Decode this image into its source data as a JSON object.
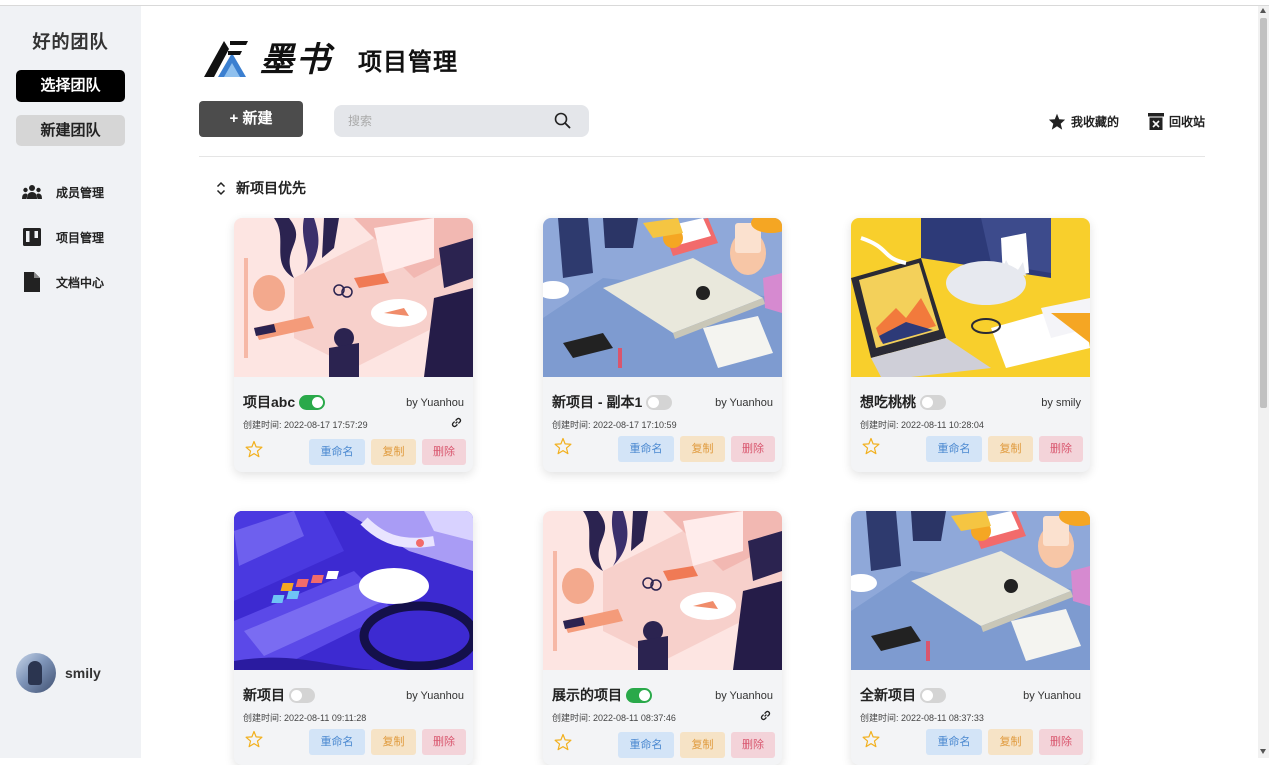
{
  "sidebar": {
    "team_name": "好的团队",
    "select_team_label": "选择团队",
    "new_team_label": "新建团队",
    "nav": [
      {
        "label": "成员管理",
        "icon": "users-icon"
      },
      {
        "label": "项目管理",
        "icon": "kanban-icon"
      },
      {
        "label": "文档中心",
        "icon": "document-icon"
      }
    ],
    "user": {
      "name": "smily"
    }
  },
  "header": {
    "logo_text": "墨书",
    "page_title": "项目管理",
    "new_button_label": "+ 新建",
    "search_placeholder": "搜索",
    "favorites_label": "我收藏的",
    "recycle_label": "回收站",
    "sort_label": "新项目优先"
  },
  "card_actions": {
    "rename": "重命名",
    "copy": "复制",
    "delete": "删除"
  },
  "projects": [
    {
      "title": "项目abc",
      "enabled": true,
      "author": "by Yuanhou",
      "created": "创建时间: 2022-08-17 17:57:29",
      "shared": true,
      "image": "desk-pink"
    },
    {
      "title": "新项目 - 副本1",
      "enabled": false,
      "author": "by Yuanhou",
      "created": "创建时间: 2022-08-17 17:10:59",
      "shared": false,
      "image": "laptop-blue"
    },
    {
      "title": "想吃桃桃",
      "enabled": false,
      "author": "by smily",
      "created": "创建时间: 2022-08-11 10:28:04",
      "shared": false,
      "image": "cat-yellow"
    },
    {
      "title": "新项目",
      "enabled": false,
      "author": "by Yuanhou",
      "created": "创建时间: 2022-08-11 09:11:28",
      "shared": false,
      "image": "music-purple"
    },
    {
      "title": "展示的项目",
      "enabled": true,
      "author": "by Yuanhou",
      "created": "创建时间: 2022-08-11 08:37:46",
      "shared": true,
      "image": "desk-pink"
    },
    {
      "title": "全新项目",
      "enabled": false,
      "author": "by Yuanhou",
      "created": "创建时间: 2022-08-11 08:37:33",
      "shared": false,
      "image": "laptop-blue"
    }
  ],
  "colors": {
    "enabled_toggle": "#2aa94a",
    "rename": "#4a88d0",
    "copy": "#e09a3c",
    "delete": "#d9566e"
  }
}
